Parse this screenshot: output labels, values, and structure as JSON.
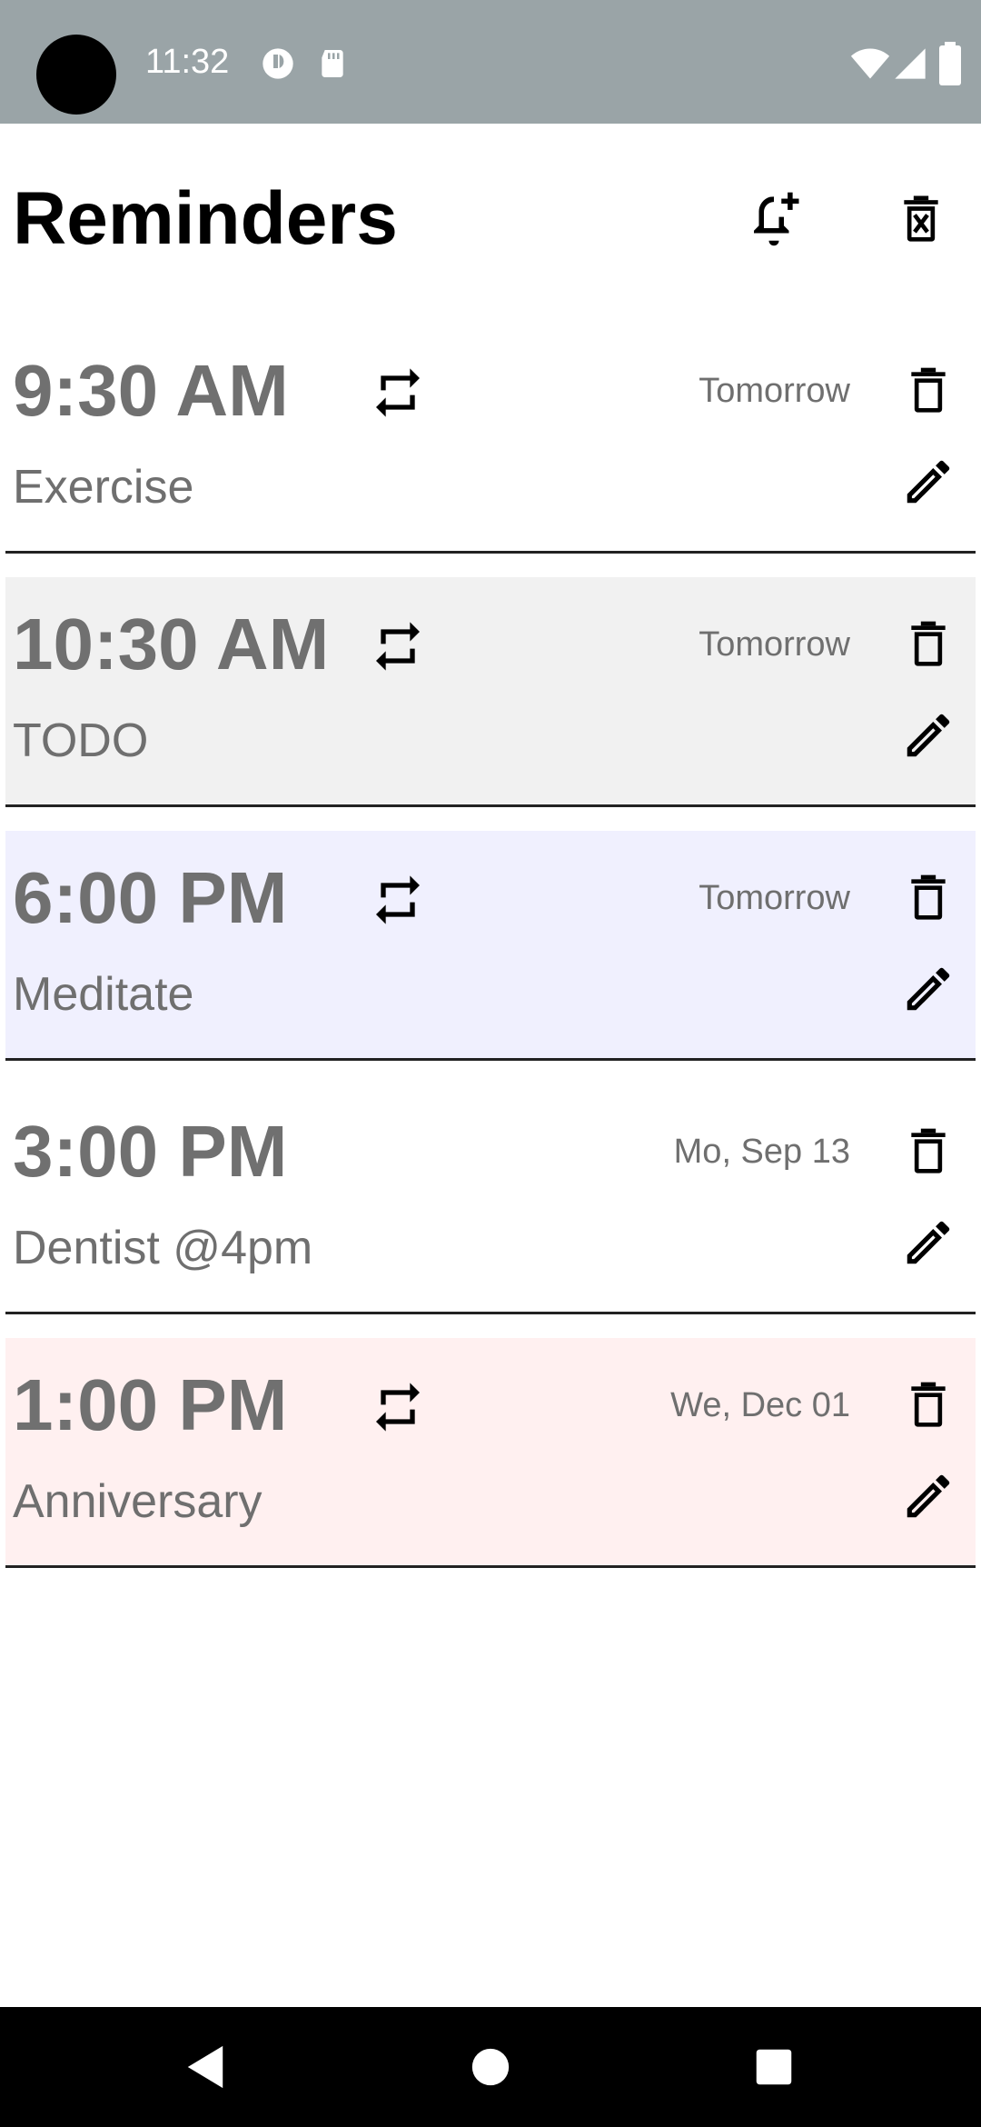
{
  "status_bar": {
    "time": "11:32",
    "icons": [
      "camera-cutout",
      "data-saver-icon",
      "sd-card-icon",
      "wifi-icon",
      "cellular-signal-icon",
      "battery-icon"
    ]
  },
  "header": {
    "title": "Reminders",
    "actions": [
      "add-alarm-icon",
      "delete-all-icon"
    ]
  },
  "reminders": [
    {
      "time": "9:30 AM",
      "label": "Exercise",
      "date": "Tomorrow",
      "repeating": true,
      "background": "#ffffff"
    },
    {
      "time": "10:30 AM",
      "label": "TODO",
      "date": "Tomorrow",
      "repeating": true,
      "background": "#f1f1f1"
    },
    {
      "time": "6:00 PM",
      "label": "Meditate",
      "date": "Tomorrow",
      "repeating": true,
      "background": "#f0f0fe"
    },
    {
      "time": "3:00 PM",
      "label": "Dentist @4pm",
      "date": "Mo, Sep 13",
      "repeating": false,
      "background": "#ffffff"
    },
    {
      "time": "1:00 PM",
      "label": "Anniversary",
      "date": "We, Dec 01",
      "repeating": true,
      "background": "#fff0f0"
    }
  ],
  "nav_bar": {
    "buttons": [
      "back-icon",
      "home-icon",
      "recents-icon"
    ]
  },
  "colors": {
    "status_bar": "#9aa4a7",
    "time_text": "#707070",
    "secondary_text": "#6f6f6f",
    "divider": "#222222",
    "nav_bar": "#000000"
  }
}
